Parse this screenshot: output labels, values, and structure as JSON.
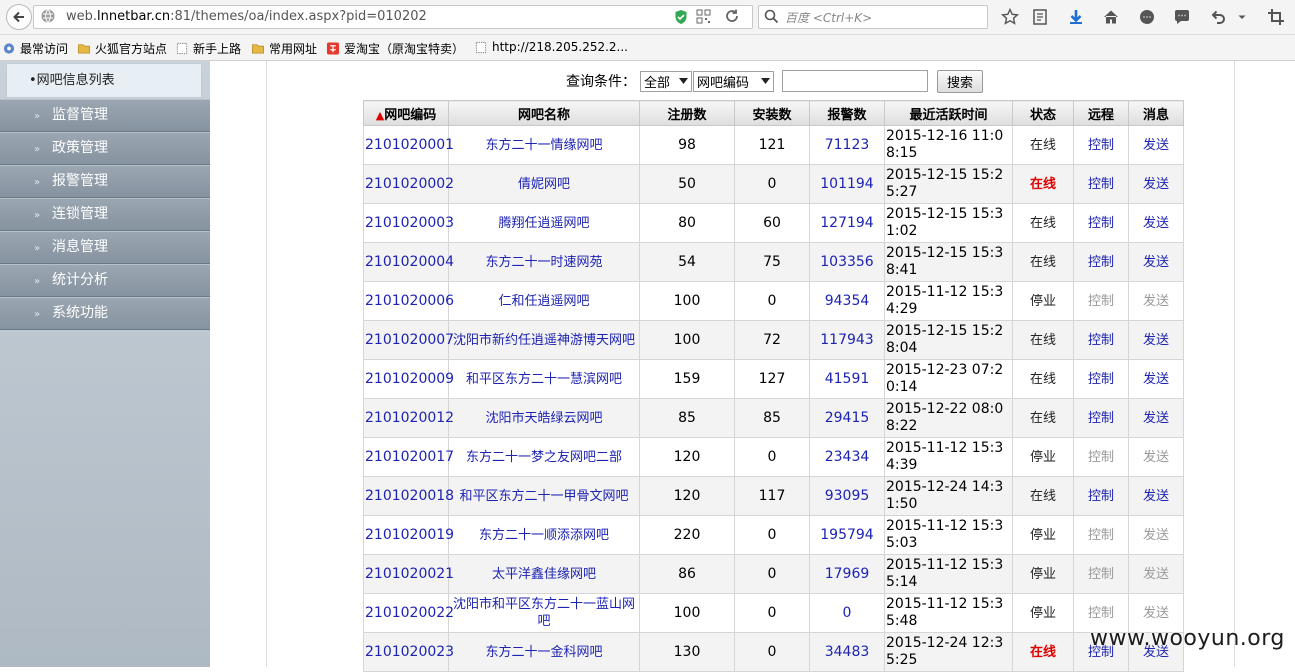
{
  "browser": {
    "url_prefix": "web.",
    "url_host": "lnnetbar.cn",
    "url_rest": ":81/themes/oa/index.aspx?pid=010202",
    "search_placeholder": "百度 <Ctrl+K>"
  },
  "bookmarks": [
    {
      "label": "最常访问",
      "icon": "gear-icon"
    },
    {
      "label": "火狐官方站点",
      "icon": "folder-icon"
    },
    {
      "label": "新手上路",
      "icon": "page-icon"
    },
    {
      "label": "常用网址",
      "icon": "folder-icon"
    },
    {
      "label": "爱淘宝（原淘宝特卖）",
      "icon": "taobao-icon"
    },
    {
      "label": "http://218.205.252.2...",
      "icon": "page-icon"
    }
  ],
  "sidebar": {
    "current": "•网吧信息列表",
    "items": [
      "监督管理",
      "政策管理",
      "报警管理",
      "连锁管理",
      "消息管理",
      "统计分析",
      "系统功能"
    ]
  },
  "query": {
    "label": "查询条件：",
    "scope_value": "全部",
    "field_value": "网吧编码",
    "search_button": "搜索"
  },
  "table": {
    "sort_marker": "▲",
    "headers": [
      "网吧编码",
      "网吧名称",
      "注册数",
      "安装数",
      "报警数",
      "最近活跃时间",
      "状态",
      "远程",
      "消息"
    ],
    "rows": [
      {
        "code": "2101020001",
        "name": "东方二十一情缘网吧",
        "reg": "98",
        "inst": "121",
        "alarm": "71123",
        "time": "2015-12-16 11:08:15",
        "status": "在线",
        "status_alert": false,
        "remote": "控制",
        "msg": "发送",
        "enabled": true
      },
      {
        "code": "2101020002",
        "name": "倩妮网吧",
        "reg": "50",
        "inst": "0",
        "alarm": "101194",
        "time": "2015-12-15 15:25:27",
        "status": "在线",
        "status_alert": true,
        "remote": "控制",
        "msg": "发送",
        "enabled": true
      },
      {
        "code": "2101020003",
        "name": "腾翔任逍遥网吧",
        "reg": "80",
        "inst": "60",
        "alarm": "127194",
        "time": "2015-12-15 15:31:02",
        "status": "在线",
        "status_alert": false,
        "remote": "控制",
        "msg": "发送",
        "enabled": true
      },
      {
        "code": "2101020004",
        "name": "东方二十一时速网苑",
        "reg": "54",
        "inst": "75",
        "alarm": "103356",
        "time": "2015-12-15 15:38:41",
        "status": "在线",
        "status_alert": false,
        "remote": "控制",
        "msg": "发送",
        "enabled": true
      },
      {
        "code": "2101020006",
        "name": "仁和任逍遥网吧",
        "reg": "100",
        "inst": "0",
        "alarm": "94354",
        "time": "2015-11-12 15:34:29",
        "status": "停业",
        "status_alert": false,
        "remote": "控制",
        "msg": "发送",
        "enabled": false
      },
      {
        "code": "2101020007",
        "name": "沈阳市新约任逍遥神游博天网吧",
        "reg": "100",
        "inst": "72",
        "alarm": "117943",
        "time": "2015-12-15 15:28:04",
        "status": "在线",
        "status_alert": false,
        "remote": "控制",
        "msg": "发送",
        "enabled": true
      },
      {
        "code": "2101020009",
        "name": "和平区东方二十一慧滨网吧",
        "reg": "159",
        "inst": "127",
        "alarm": "41591",
        "time": "2015-12-23 07:20:14",
        "status": "在线",
        "status_alert": false,
        "remote": "控制",
        "msg": "发送",
        "enabled": true
      },
      {
        "code": "2101020012",
        "name": "沈阳市天皓绿云网吧",
        "reg": "85",
        "inst": "85",
        "alarm": "29415",
        "time": "2015-12-22 08:08:22",
        "status": "在线",
        "status_alert": false,
        "remote": "控制",
        "msg": "发送",
        "enabled": true
      },
      {
        "code": "2101020017",
        "name": "东方二十一梦之友网吧二部",
        "reg": "120",
        "inst": "0",
        "alarm": "23434",
        "time": "2015-11-12 15:34:39",
        "status": "停业",
        "status_alert": false,
        "remote": "控制",
        "msg": "发送",
        "enabled": false
      },
      {
        "code": "2101020018",
        "name": "和平区东方二十一甲骨文网吧",
        "reg": "120",
        "inst": "117",
        "alarm": "93095",
        "time": "2015-12-24 14:31:50",
        "status": "在线",
        "status_alert": false,
        "remote": "控制",
        "msg": "发送",
        "enabled": true
      },
      {
        "code": "2101020019",
        "name": "东方二十一顺添添网吧",
        "reg": "220",
        "inst": "0",
        "alarm": "195794",
        "time": "2015-11-12 15:35:03",
        "status": "停业",
        "status_alert": false,
        "remote": "控制",
        "msg": "发送",
        "enabled": false
      },
      {
        "code": "2101020021",
        "name": "太平洋鑫佳缘网吧",
        "reg": "86",
        "inst": "0",
        "alarm": "17969",
        "time": "2015-11-12 15:35:14",
        "status": "停业",
        "status_alert": false,
        "remote": "控制",
        "msg": "发送",
        "enabled": false
      },
      {
        "code": "2101020022",
        "name": "沈阳市和平区东方二十一蓝山网吧",
        "reg": "100",
        "inst": "0",
        "alarm": "0",
        "time": "2015-11-12 15:35:48",
        "status": "停业",
        "status_alert": false,
        "remote": "控制",
        "msg": "发送",
        "enabled": false
      },
      {
        "code": "2101020023",
        "name": "东方二十一金科网吧",
        "reg": "130",
        "inst": "0",
        "alarm": "34483",
        "time": "2015-12-24 12:35:25",
        "status": "在线",
        "status_alert": true,
        "remote": "控制",
        "msg": "发送",
        "enabled": true
      }
    ]
  },
  "watermark": "www.wooyun.org",
  "colors": {
    "link": "#1d23b3",
    "alert": "#e00000",
    "disabled": "#9a9a9a",
    "sidebar": "#8693a0"
  }
}
